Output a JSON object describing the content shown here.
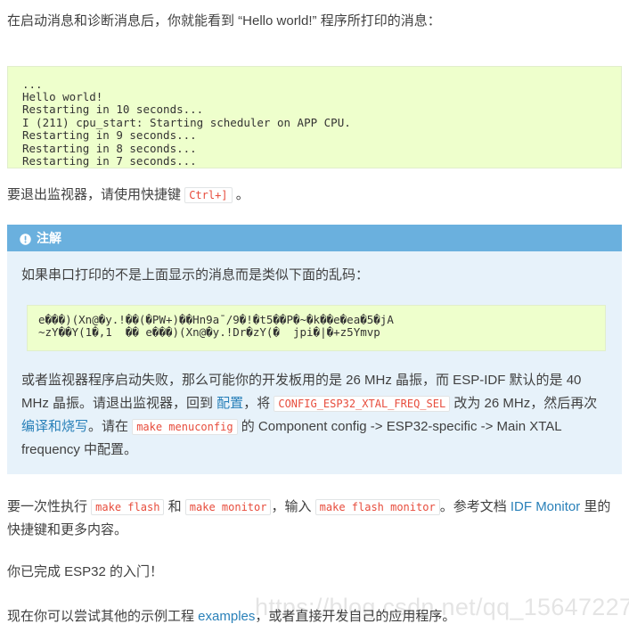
{
  "intro": {
    "text": "在启动消息和诊断消息后，你就能看到 “Hello world!” 程序所打印的消息："
  },
  "console_output": {
    "lines": "...\nHello world!\nRestarting in 10 seconds...\nI (211) cpu_start: Starting scheduler on APP CPU.\nRestarting in 9 seconds...\nRestarting in 8 seconds...\nRestarting in 7 seconds..."
  },
  "exit_monitor": {
    "prefix": "要退出监视器，请使用快捷键",
    "shortcut": "Ctrl+]",
    "suffix": "。"
  },
  "note": {
    "icon": "info-circle-icon",
    "title": "注解",
    "intro": "如果串口打印的不是上面显示的消息而是类似下面的乱码：",
    "garbled": "e���)(Xn@�y.!��(�PW+)��Hn9a¯/9�!�t5��P�~�k��e�ea�5�jA\n~zY��Y(1�,1  �� e���)(Xn@�y.!Dr�zY(�  jpi�|�+z5Ymvp",
    "body_seg1": "或者监视器程序启动失败，那么可能你的开发板用的是 26 MHz 晶振，而 ESP-IDF 默认的是 40 MHz 晶振。请退出监视器，回到 ",
    "link_config": "配置",
    "body_seg2": "，将 ",
    "code_xtal": "CONFIG_ESP32_XTAL_FREQ_SEL",
    "body_seg3": " 改为 26 MHz，然后再次",
    "link_build_flash": "编译和烧写",
    "body_seg4": "。请在 ",
    "code_menuconfig": "make menuconfig",
    "body_seg5": " 的 Component config -> ESP32-specific -> Main XTAL frequency 中配置。"
  },
  "tail": {
    "seg1": "要一次性执行 ",
    "code_flash": "make flash",
    "seg2": " 和 ",
    "code_monitor": "make monitor",
    "seg3": "，输入 ",
    "code_flash_monitor": "make flash monitor",
    "seg4": "。参考文档 ",
    "link_idf_monitor": "IDF Monitor",
    "seg5": " 里的快捷键和更多内容。"
  },
  "done": {
    "text": "你已完成 ESP32 的入门！"
  },
  "final": {
    "seg1": "现在你可以尝试其他的示例工程 ",
    "link_examples": "examples",
    "seg2": "，或者直接开发自己的应用程序。"
  },
  "watermark": {
    "text": "https://blog.csdn.net/qq_15647227"
  },
  "colors": {
    "note_header_bg": "#6ab0de",
    "note_body_bg": "#e7f2fa",
    "code_bg": "#eeffcc",
    "code_border": "#e1eecc",
    "inline_code_text": "#e74c3c",
    "link": "#2980b9",
    "body_text": "#404040"
  }
}
